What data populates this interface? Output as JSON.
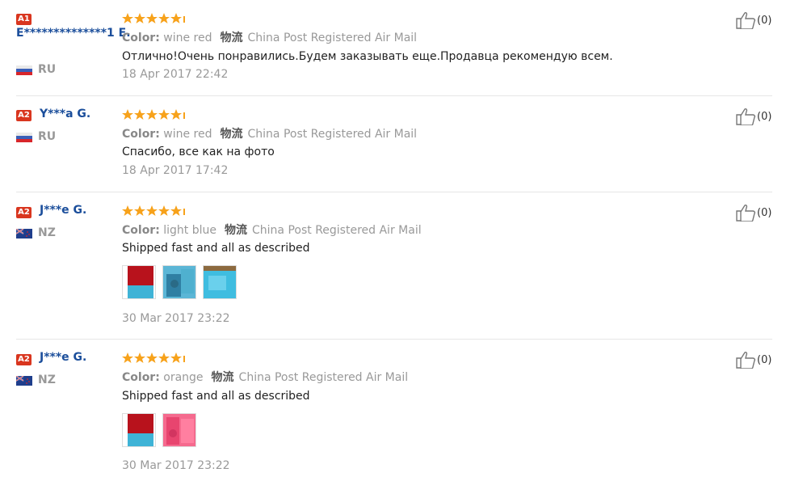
{
  "colors": {
    "accent_badge": "#d9361f",
    "username": "#1b4e9b",
    "star": "#f7a21b"
  },
  "reviews": [
    {
      "level": "A1",
      "username": "E**************1 E.",
      "country": "RU",
      "rating": 5,
      "color_label": "Color:",
      "color_value": "wine red",
      "ship_label": "物流",
      "shipping": "China Post Registered Air Mail",
      "text": "Отлично!Очень понравились.Будем заказывать еще.Продавца рекомендую всем.",
      "date": "18 Apr 2017 22:42",
      "helpful": "(0)",
      "photos": []
    },
    {
      "level": "A2",
      "username": "Y***a G.",
      "country": "RU",
      "rating": 5,
      "color_label": "Color:",
      "color_value": "wine red",
      "ship_label": "物流",
      "shipping": "China Post Registered Air Mail",
      "text": "Спасибо, все как на фото",
      "date": "18 Apr 2017 17:42",
      "helpful": "(0)",
      "photos": []
    },
    {
      "level": "A2",
      "username": "J***e G.",
      "country": "NZ",
      "rating": 5,
      "color_label": "Color:",
      "color_value": "light blue",
      "ship_label": "物流",
      "shipping": "China Post Registered Air Mail",
      "text": "Shipped fast and all as described",
      "date": "30 Mar 2017 23:22",
      "helpful": "(0)",
      "photos": [
        "photo-1",
        "photo-2",
        "photo-3"
      ]
    },
    {
      "level": "A2",
      "username": "J***e G.",
      "country": "NZ",
      "rating": 5,
      "color_label": "Color:",
      "color_value": "orange",
      "ship_label": "物流",
      "shipping": "China Post Registered Air Mail",
      "text": "Shipped fast and all as described",
      "date": "30 Mar 2017 23:22",
      "helpful": "(0)",
      "photos": [
        "photo-1",
        "photo-2"
      ]
    }
  ]
}
